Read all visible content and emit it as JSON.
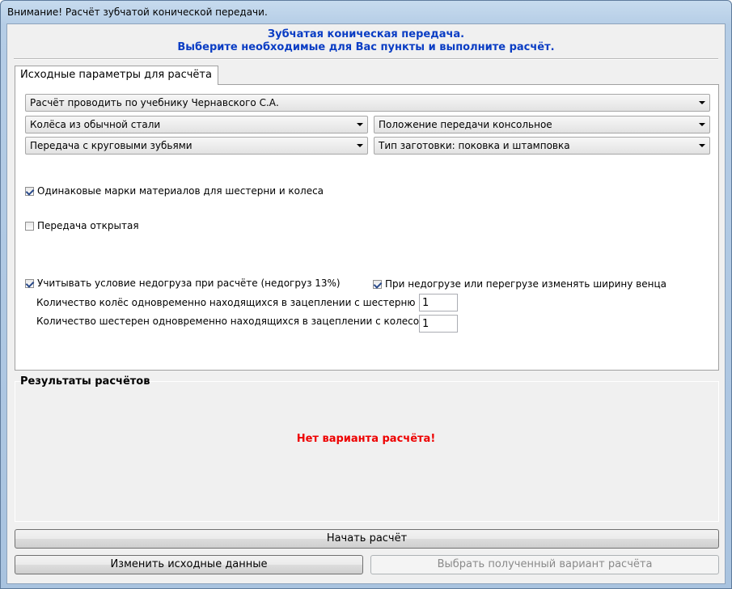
{
  "window": {
    "title": "Внимание! Расчёт зубчатой конической передачи."
  },
  "header": {
    "line1": "Зубчатая коническая передача.",
    "line2": "Выберите необходимые для Вас пункты и выполните расчёт."
  },
  "tab": {
    "label": "Исходные параметры для расчёта"
  },
  "combos": {
    "textbook": "Расчёт проводить по учебнику Чернавского С.А.",
    "material": "Колёса из обычной стали",
    "position": "Положение передачи консольное",
    "teeth": "Передача с круговыми зубьями",
    "blank": "Тип заготовки: поковка и штамповка"
  },
  "checks": {
    "same_materials": {
      "label": "Одинаковые марки материалов для шестерни и колеса",
      "checked": true
    },
    "open_gear": {
      "label": "Передача открытая",
      "checked": false
    },
    "underload": {
      "label": "Учитывать условие недогруза при расчёте (недогруз 13%)",
      "checked": true
    },
    "change_width": {
      "label": "При недогрузе или перегрузе изменять ширину венца",
      "checked": true
    }
  },
  "fields": {
    "wheels_count": {
      "label": "Количество колёс одновременно находящихся в зацеплении с шестерню",
      "value": "1"
    },
    "pinions_count": {
      "label": "Количество шестерен одновременно находящихся в зацеплении с колесом",
      "value": "1"
    }
  },
  "results": {
    "title": "Результаты расчётов",
    "message": "Нет варианта расчёта!",
    "message_color": "#ee0000"
  },
  "buttons": {
    "start": "Начать расчёт",
    "change": "Изменить исходные данные",
    "select": "Выбрать полученный вариант расчёта"
  }
}
